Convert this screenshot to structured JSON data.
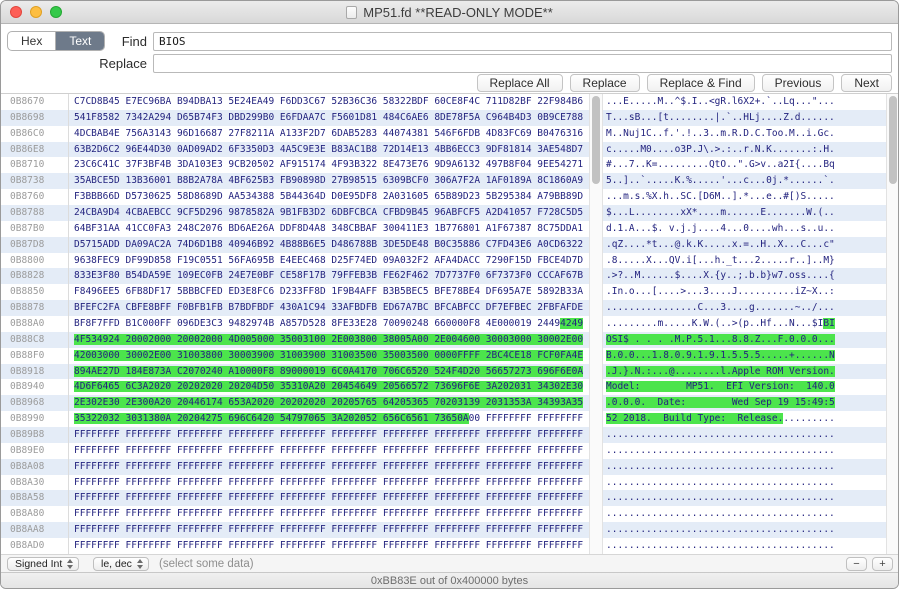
{
  "window": {
    "title": "MP51.fd **READ-ONLY MODE**"
  },
  "find_bar": {
    "segments": [
      {
        "label": "Hex",
        "selected": false
      },
      {
        "label": "Text",
        "selected": true
      }
    ],
    "find_label": "Find",
    "find_value": "BIOS",
    "replace_label": "Replace",
    "replace_value": "",
    "buttons": [
      "Replace All",
      "Replace",
      "Replace & Find",
      "Previous",
      "Next"
    ]
  },
  "hex_view": {
    "bytes_per_row": 40,
    "rows": [
      {
        "a": "0B8670",
        "h": "C7CD8B45 E7EC96BA B94DBA13 5E24EA49 F6DD3C67 52B36C36 58322BDF 60CE8F4C 711D82BF 22F984B6",
        "hl": null
      },
      {
        "a": "0B8698",
        "h": "541F8582 7342A294 D65B74F3 DBD299B0 E6FDAA7C F5601D81 484C6AE6 8DE78F5A C964B4D3 0B9CE788",
        "hl": null
      },
      {
        "a": "0B86C0",
        "h": "4DCBAB4E 756A3143 96D16687 27F8211A A133F2D7 6DAB5283 44074381 546F6FDB 4D83FC69 B0476316",
        "hl": null
      },
      {
        "a": "0B86E8",
        "h": "63B2D6C2 96E44D30 0AD09AD2 6F3350D3 4A5C9E3E B83AC1B8 72D14E13 4BB6ECC3 9DF81814 3AE548D7",
        "hl": null
      },
      {
        "a": "0B8710",
        "h": "23C6C41C 37F3BF4B 3DA103E3 9CB20502 AF915174 4F93B322 8E473E76 9D9A6132 497B8F04 9EE54271",
        "hl": null
      },
      {
        "a": "0B8738",
        "h": "35ABCE5D 13B36001 B8B2A78A 4BF625B3 FB90898D 27B98515 6309BCF0 306A7F2A 1AF0189A 8C1860A9",
        "hl": null
      },
      {
        "a": "0B8760",
        "h": "F3BBB66D D5730625 58D8689D AA534388 5B44364D D0E95DF8 2A031605 65B89D23 5B295384 A79BB89D",
        "hl": null
      },
      {
        "a": "0B8788",
        "h": "24CBA9D4 4CBAEBCC 9CF5D296 9878582A 9B1FB3D2 6DBFCBCA CFBD9B45 96ABFCF5 A2D41057 F728C5D5",
        "hl": null
      },
      {
        "a": "0B87B0",
        "h": "64BF31AA 41CC0FA3 248C2076 BD6AE26A DDF8D4A8 348CBBAF 300411E3 1B776801 A1F67387 8C75DDA1",
        "hl": null
      },
      {
        "a": "0B87D8",
        "h": "D5715ADD DA09AC2A 74D6D1B8 40946B92 4B88B6E5 D486788B 3DE5DE48 B0C35886 C7FD43E6 A0CD6322",
        "hl": null
      },
      {
        "a": "0B8800",
        "h": "9638FEC9 DF99D858 F19C0551 56FA695B E4EEC468 D25F74ED 09A032F2 AFA4DACC 7290F15D FBCE4D7D",
        "hl": null
      },
      {
        "a": "0B8828",
        "h": "833E3F80 B54DA59E 109EC0FB 24E7E0BF CE58F17B 79FFEB3B FE62F462 7D7737F0 6F7373F0 CCCAF67B",
        "hl": null
      },
      {
        "a": "0B8850",
        "h": "F8496EE5 6FB8DF17 5BBBCFED ED3E8FC6 D233FF8D 1F9B4AFF B3B5BEC5 BFE78BE4 DF695A7E 5892B33A",
        "hl": null
      },
      {
        "a": "0B8878",
        "h": "BFEFC2FA CBFE8BFF F0BFB1FB B7BDFBDF 430A1C94 33AFBDFB ED67A7BC BFCABFCC DF7EFBEC 2FBFAFDE",
        "hl": null
      },
      {
        "a": "0B88A0",
        "h": "BF8F7FFD B1C000FF 096DE3C3 9482974B A857D528 8FE33E28 70090248 660000F8 4E000019 24494249",
        "hl": [
          38,
          40
        ]
      },
      {
        "a": "0B88C8",
        "h": "4F534924 20002000 20002000 4D005000 35003100 2E003800 38005A00 2E004600 30003000 30002E00",
        "hl": [
          0,
          40
        ]
      },
      {
        "a": "0B88F0",
        "h": "42003000 30002E00 31003800 30003900 31003900 31003500 35003500 0000FFFF 2BC4CE18 FCF0FA4E",
        "hl": [
          0,
          40
        ]
      },
      {
        "a": "0B8918",
        "h": "894AE27D 184E873A C2070240 A10000F8 89000019 6C0A4170 706C6520 524F4D20 56657273 696F6E0A",
        "hl": [
          0,
          40
        ]
      },
      {
        "a": "0B8940",
        "h": "4D6F6465 6C3A2020 20202020 20204D50 35310A20 20454649 20566572 73696F6E 3A202031 34302E30",
        "hl": [
          0,
          40
        ]
      },
      {
        "a": "0B8968",
        "h": "2E302E30 2E300A20 20446174 653A2020 20202020 20205765 64205365 70203139 2031353A 34393A35",
        "hl": [
          0,
          40
        ]
      },
      {
        "a": "0B8990",
        "h": "35322032 3031380A 20204275 696C6420 54797065 3A202052 656C6561 73650A00 FFFFFFFF FFFFFFFF",
        "hl": [
          0,
          31
        ]
      },
      {
        "a": "0B89B8",
        "h": "FFFFFFFF FFFFFFFF FFFFFFFF FFFFFFFF FFFFFFFF FFFFFFFF FFFFFFFF FFFFFFFF FFFFFFFF FFFFFFFF",
        "hl": null
      },
      {
        "a": "0B89E0",
        "h": "FFFFFFFF FFFFFFFF FFFFFFFF FFFFFFFF FFFFFFFF FFFFFFFF FFFFFFFF FFFFFFFF FFFFFFFF FFFFFFFF",
        "hl": null
      },
      {
        "a": "0B8A08",
        "h": "FFFFFFFF FFFFFFFF FFFFFFFF FFFFFFFF FFFFFFFF FFFFFFFF FFFFFFFF FFFFFFFF FFFFFFFF FFFFFFFF",
        "hl": null
      },
      {
        "a": "0B8A30",
        "h": "FFFFFFFF FFFFFFFF FFFFFFFF FFFFFFFF FFFFFFFF FFFFFFFF FFFFFFFF FFFFFFFF FFFFFFFF FFFFFFFF",
        "hl": null
      },
      {
        "a": "0B8A58",
        "h": "FFFFFFFF FFFFFFFF FFFFFFFF FFFFFFFF FFFFFFFF FFFFFFFF FFFFFFFF FFFFFFFF FFFFFFFF FFFFFFFF",
        "hl": null
      },
      {
        "a": "0B8A80",
        "h": "FFFFFFFF FFFFFFFF FFFFFFFF FFFFFFFF FFFFFFFF FFFFFFFF FFFFFFFF FFFFFFFF FFFFFFFF FFFFFFFF",
        "hl": null
      },
      {
        "a": "0B8AA8",
        "h": "FFFFFFFF FFFFFFFF FFFFFFFF FFFFFFFF FFFFFFFF FFFFFFFF FFFFFFFF FFFFFFFF FFFFFFFF FFFFFFFF",
        "hl": null
      },
      {
        "a": "0B8AD0",
        "h": "FFFFFFFF FFFFFFFF FFFFFFFF FFFFFFFF FFFFFFFF FFFFFFFF FFFFFFFF FFFFFFFF FFFFFFFF FFFFFFFF",
        "hl": null
      }
    ]
  },
  "inspector": {
    "type_selector": "Signed Int",
    "format_selector": "le, dec",
    "placeholder": "(select some data)",
    "remove_label": "−",
    "add_label": "+"
  },
  "status_bar": {
    "text": "0xBB83E out of 0x400000 bytes"
  },
  "colors": {
    "highlight": "#4ce44c",
    "row_stripe": "#e4ecf7",
    "hex_text": "#23237f",
    "address_text": "#9b9b9b",
    "segment_selected": "#6e7a8a"
  }
}
